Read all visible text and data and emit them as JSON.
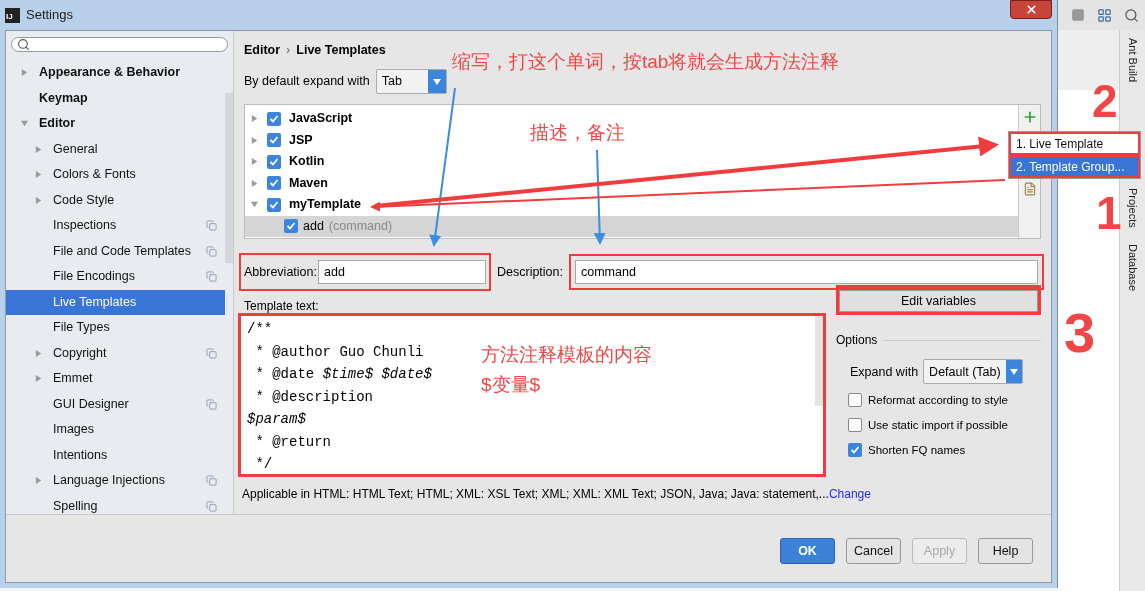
{
  "window": {
    "app_icon": "IJ",
    "title": "Settings"
  },
  "sidebar": {
    "items": [
      {
        "label": "Appearance & Behavior",
        "bold": true,
        "expanded": false
      },
      {
        "label": "Keymap",
        "bold": true
      },
      {
        "label": "Editor",
        "bold": true,
        "expanded": true,
        "children": [
          {
            "label": "General",
            "expanded": false
          },
          {
            "label": "Colors & Fonts",
            "expanded": false
          },
          {
            "label": "Code Style",
            "expanded": false
          },
          {
            "label": "Inspections",
            "scope_icon": true
          },
          {
            "label": "File and Code Templates",
            "scope_icon": true
          },
          {
            "label": "File Encodings",
            "scope_icon": true
          },
          {
            "label": "Live Templates",
            "selected": true
          },
          {
            "label": "File Types"
          },
          {
            "label": "Copyright",
            "expanded": false,
            "scope_icon": true
          },
          {
            "label": "Emmet",
            "expanded": false
          },
          {
            "label": "GUI Designer",
            "scope_icon": true
          },
          {
            "label": "Images"
          },
          {
            "label": "Intentions"
          },
          {
            "label": "Language Injections",
            "expanded": false,
            "scope_icon": true
          },
          {
            "label": "Spelling",
            "scope_icon": true
          }
        ]
      }
    ]
  },
  "breadcrumb": {
    "parent": "Editor",
    "separator": "›",
    "current": "Live Templates"
  },
  "expand_default": {
    "label": "By default expand with",
    "value": "Tab"
  },
  "template_groups": [
    {
      "label": "JavaScript",
      "checked": true,
      "expanded": false
    },
    {
      "label": "JSP",
      "checked": true,
      "expanded": false
    },
    {
      "label": "Kotlin",
      "checked": true,
      "expanded": false
    },
    {
      "label": "Maven",
      "checked": true,
      "expanded": false
    },
    {
      "label": "myTemplate",
      "checked": true,
      "expanded": true,
      "children": [
        {
          "abbreviation": "add",
          "description": "(command)",
          "checked": true,
          "selected": true
        }
      ]
    }
  ],
  "add_menu": [
    {
      "label": "1. Live Template",
      "selected": false
    },
    {
      "label": "2. Template Group...",
      "selected": true
    }
  ],
  "abbreviation": {
    "label": "Abbreviation:",
    "value": "add"
  },
  "description": {
    "label": "Description:",
    "value": "command"
  },
  "template_text": {
    "label": "Template text:",
    "lines": [
      "/**",
      " * @author Guo Chunli",
      " * @date *$time$* *$date$*",
      " * @description",
      "*$param$*",
      " * @return",
      " */"
    ]
  },
  "applicable": {
    "text": "Applicable in HTML: HTML Text; HTML; XML: XSL Text; XML; XML: XML Text; JSON, Java; Java: statement,...",
    "link": "Change"
  },
  "edit_variables": "Edit variables",
  "options": {
    "title": "Options",
    "expand_label": "Expand with",
    "expand_value": "Default (Tab)",
    "checkboxes": [
      {
        "label": "Reformat according to style",
        "checked": false
      },
      {
        "label": "Use static import if possible",
        "checked": false
      },
      {
        "label": "Shorten FQ names",
        "checked": true
      }
    ]
  },
  "buttons": [
    {
      "label": "OK",
      "kind": "default"
    },
    {
      "label": "Cancel",
      "kind": "normal"
    },
    {
      "label": "Apply",
      "kind": "disabled"
    },
    {
      "label": "Help",
      "kind": "normal"
    }
  ],
  "tool_windows": [
    "Ant Build",
    "Projects",
    "Database"
  ],
  "annotations": {
    "abbreviation_note": "缩写，打这个单词，按tab将就会生成方法注释",
    "description_note": "描述，备注",
    "template_note": "方法注释模板的内容",
    "variable_note": "$变量$",
    "step_numbers": [
      "2",
      "1",
      "3"
    ]
  }
}
